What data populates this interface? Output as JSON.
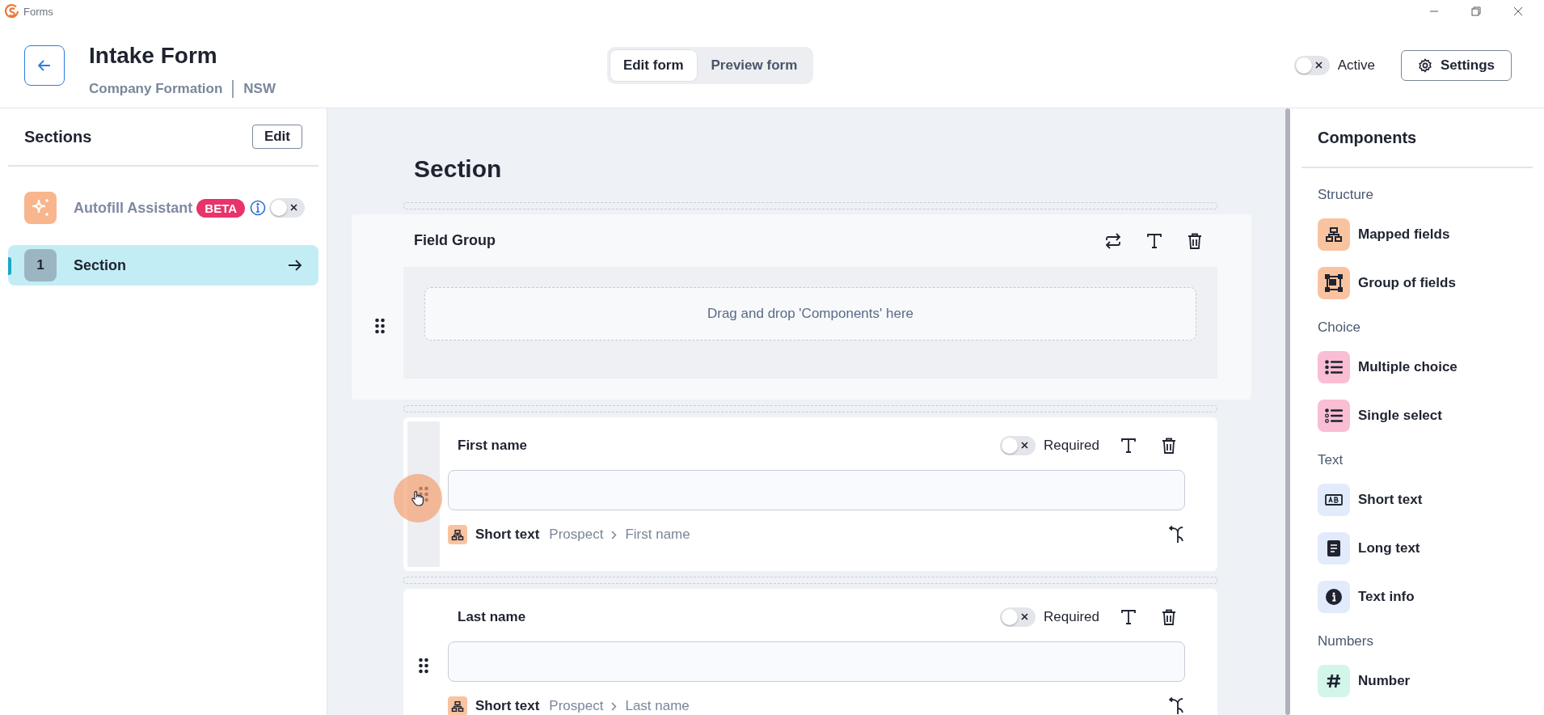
{
  "window": {
    "title": "Forms"
  },
  "header": {
    "title": "Intake Form",
    "breadcrumb": [
      "Company Formation",
      "NSW"
    ],
    "mode_tabs": [
      {
        "label": "Edit form",
        "selected": true
      },
      {
        "label": "Preview form",
        "selected": false
      }
    ],
    "active_toggle": {
      "label": "Active",
      "on": false
    },
    "settings_button": "Settings"
  },
  "sections_panel": {
    "title": "Sections",
    "edit_button": "Edit",
    "autofill": {
      "label": "Autofill Assistant",
      "badge": "BETA",
      "on": false
    },
    "items": [
      {
        "number": "1",
        "label": "Section",
        "selected": true
      }
    ]
  },
  "canvas": {
    "heading": "Section",
    "blocks": [
      {
        "kind": "group",
        "title": "Field Group",
        "drop_hint": "Drag and drop 'Components' here"
      },
      {
        "kind": "field",
        "label": "First name",
        "required": false,
        "required_label": "Required",
        "type": "Short text",
        "path": [
          "Prospect",
          "First name"
        ],
        "hovered": true
      },
      {
        "kind": "field",
        "label": "Last name",
        "required": false,
        "required_label": "Required",
        "type": "Short text",
        "path": [
          "Prospect",
          "Last name"
        ],
        "hovered": false
      }
    ]
  },
  "components_panel": {
    "title": "Components",
    "groups": [
      {
        "name": "Structure",
        "items": [
          {
            "label": "Mapped fields",
            "kind": "mapped"
          },
          {
            "label": "Group of fields",
            "kind": "group"
          }
        ]
      },
      {
        "name": "Choice",
        "items": [
          {
            "label": "Multiple choice",
            "kind": "multi"
          },
          {
            "label": "Single select",
            "kind": "single"
          }
        ]
      },
      {
        "name": "Text",
        "items": [
          {
            "label": "Short text",
            "kind": "short"
          },
          {
            "label": "Long text",
            "kind": "long"
          },
          {
            "label": "Text info",
            "kind": "info"
          }
        ]
      },
      {
        "name": "Numbers",
        "items": [
          {
            "label": "Number",
            "kind": "number"
          }
        ]
      }
    ]
  }
}
